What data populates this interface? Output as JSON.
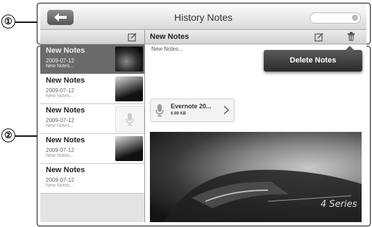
{
  "callouts": {
    "one": "①",
    "two": "②"
  },
  "topbar": {
    "title": "History Notes",
    "search_placeholder": ""
  },
  "subbar": {
    "note_title": "New Notes"
  },
  "notes": [
    {
      "name": "New Notes",
      "date": "2009-07-12",
      "preview": "New Notes...",
      "thumbnail": "car-tail-photo",
      "selected": true
    },
    {
      "name": "New Notes",
      "date": "2009-07-12",
      "preview": "New Notes...",
      "thumbnail": "car-photo",
      "selected": false
    },
    {
      "name": "New Notes",
      "date": "2009-07-12",
      "preview": "New Notes...",
      "thumbnail": "microphone-icon",
      "selected": false
    },
    {
      "name": "New Notes",
      "date": "2009-07-12",
      "preview": "New Notes...",
      "thumbnail": "car-photo",
      "selected": false
    },
    {
      "name": "New Notes",
      "date": "2009-07-12",
      "preview": "New Notes...",
      "thumbnail": "",
      "selected": false
    }
  ],
  "content": {
    "excerpt": "New Notes...",
    "attachment": {
      "name": "Evernote 20...",
      "size": "6.98 KB"
    },
    "photo_badge": "4 Series"
  },
  "popup": {
    "delete_label": "Delete Notes"
  }
}
